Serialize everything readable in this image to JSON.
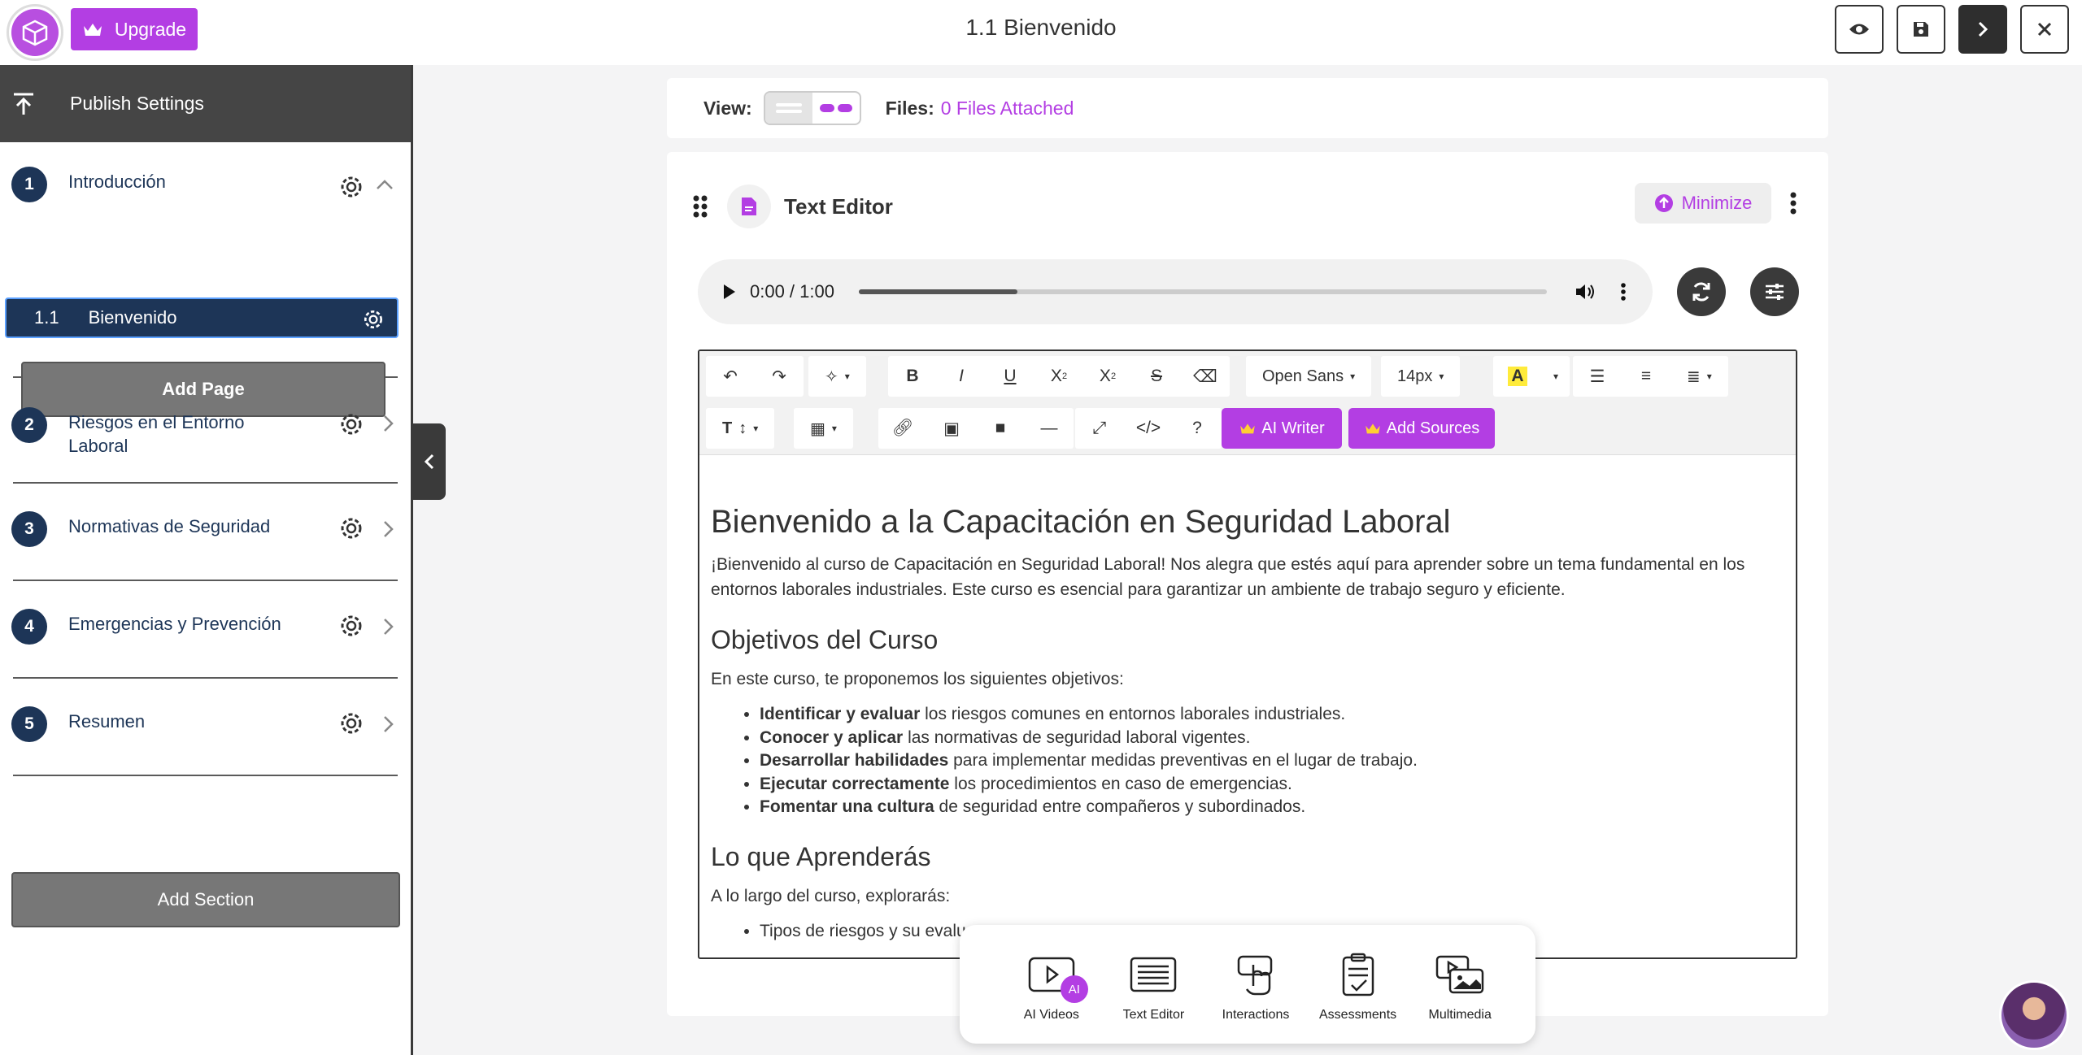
{
  "header": {
    "upgrade_label": "Upgrade",
    "title": "1.1 Bienvenido"
  },
  "sidebar": {
    "publish_label": "Publish Settings",
    "sections": [
      {
        "num": "1",
        "label": "Introducción"
      },
      {
        "num": "2",
        "label": "Riesgos en el Entorno Laboral"
      },
      {
        "num": "3",
        "label": "Normativas de Seguridad"
      },
      {
        "num": "4",
        "label": "Emergencias y Prevención"
      },
      {
        "num": "5",
        "label": "Resumen"
      }
    ],
    "page": {
      "num": "1.1",
      "label": "Bienvenido"
    },
    "add_page_label": "Add Page",
    "add_section_label": "Add Section"
  },
  "viewbar": {
    "view_label": "View:",
    "files_label": "Files:",
    "files_link": "0 Files Attached"
  },
  "card": {
    "title": "Text Editor",
    "minimize_label": "Minimize"
  },
  "audio": {
    "time": "0:00 / 1:00",
    "progress": 0.23
  },
  "toolbar": {
    "font": "Open Sans",
    "size": "14px",
    "ai_writer": "AI Writer",
    "add_sources": "Add Sources"
  },
  "content": {
    "h1": "Bienvenido a la Capacitación en Seguridad Laboral",
    "intro": "¡Bienvenido al curso de Capacitación en Seguridad Laboral! Nos alegra que estés aquí para aprender sobre un tema fundamental en los entornos laborales industriales. Este curso es esencial para garantizar un ambiente de trabajo seguro y eficiente.",
    "h2a": "Objetivos del Curso",
    "objectives_intro": "En este curso, te proponemos los siguientes objetivos:",
    "objectives": [
      {
        "bold": "Identificar y evaluar",
        "rest": " los riesgos comunes en entornos laborales industriales."
      },
      {
        "bold": "Conocer y aplicar",
        "rest": " las normativas de seguridad laboral vigentes."
      },
      {
        "bold": "Desarrollar habilidades",
        "rest": " para implementar medidas preventivas en el lugar de trabajo."
      },
      {
        "bold": "Ejecutar correctamente",
        "rest": " los procedimientos en caso de emergencias."
      },
      {
        "bold": "Fomentar una cultura",
        "rest": " de seguridad entre compañeros y subordinados."
      }
    ],
    "h2b": "Lo que Aprenderás",
    "learn_intro": "A lo largo del curso, explorarás:",
    "learn_first": "Tipos de riesgos y su evalu"
  },
  "dock": {
    "items": [
      "AI Videos",
      "Text Editor",
      "Interactions",
      "Assessments",
      "Multimedia"
    ],
    "ai_badge": "AI"
  },
  "colors": {
    "accent": "#b33ee3",
    "navy": "#1d3557",
    "dark": "#3a3a3a"
  }
}
